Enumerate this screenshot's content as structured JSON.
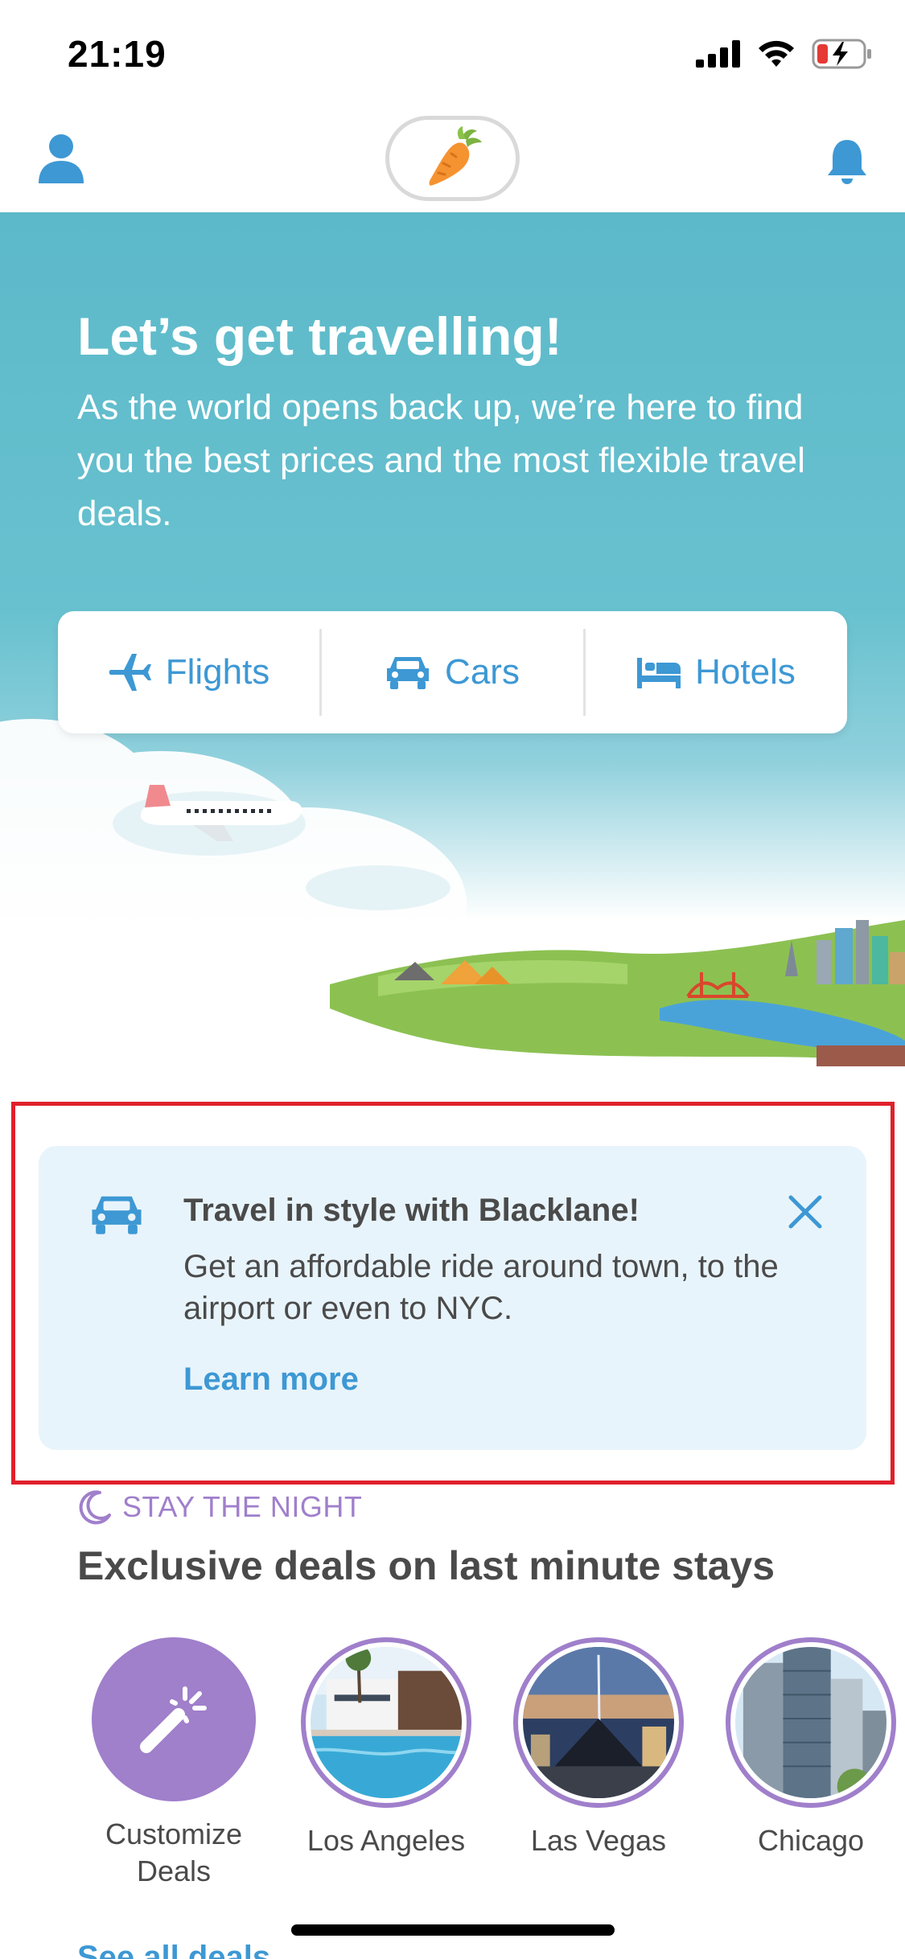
{
  "status_bar": {
    "time": "21:19",
    "icons": [
      "signal-icon",
      "wifi-icon",
      "battery-charging-icon"
    ]
  },
  "nav": {
    "profile_icon": "person-icon",
    "logo_icon": "carrot-icon",
    "bell_icon": "bell-icon"
  },
  "hero": {
    "title": "Let’s get travelling!",
    "subtitle": "As the world opens back up, we’re here to find you the best prices and the most flexible travel deals.",
    "tabs": [
      {
        "label": "Flights",
        "icon": "plane-icon"
      },
      {
        "label": "Cars",
        "icon": "car-icon"
      },
      {
        "label": "Hotels",
        "icon": "bed-icon"
      }
    ]
  },
  "promo": {
    "icon": "car-icon",
    "title": "Travel in style with Blacklane!",
    "body": "Get an affordable ride around town, to the airport or even to NYC.",
    "link": "Learn more",
    "close_icon": "close-icon"
  },
  "stay": {
    "label": "STAY THE NIGHT",
    "label_icon": "moon-icon",
    "heading": "Exclusive deals on last minute stays",
    "deals": [
      {
        "label": "Customize Deals",
        "icon": "magic-wand-icon"
      },
      {
        "label": "Los Angeles"
      },
      {
        "label": "Las Vegas"
      },
      {
        "label": "Chicago"
      }
    ],
    "see_all": "See all deals"
  },
  "colors": {
    "accent_blue": "#3d98d4",
    "hero_teal": "#5cb9c9",
    "purple": "#a07fcb",
    "promo_bg": "#e8f4fb",
    "highlight_red": "#e0202c"
  }
}
